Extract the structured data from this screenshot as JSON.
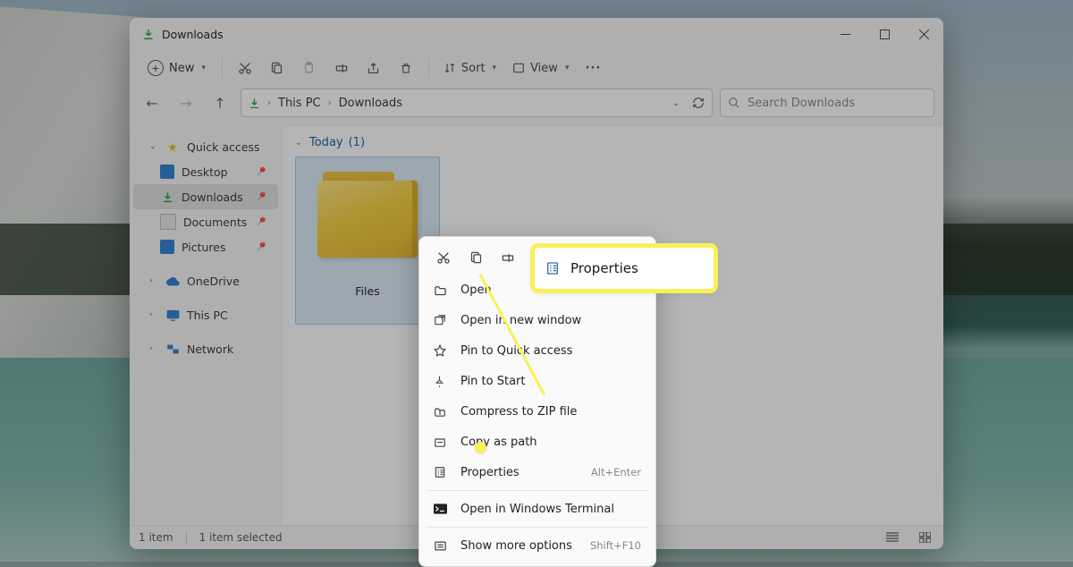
{
  "titlebar": {
    "title": "Downloads"
  },
  "toolbar": {
    "new_label": "New",
    "sort_label": "Sort",
    "view_label": "View"
  },
  "nav": {
    "breadcrumb": [
      "This PC",
      "Downloads"
    ],
    "search_placeholder": "Search Downloads"
  },
  "sidebar": {
    "quick_access": "Quick access",
    "items": [
      {
        "label": "Desktop"
      },
      {
        "label": "Downloads"
      },
      {
        "label": "Documents"
      },
      {
        "label": "Pictures"
      }
    ],
    "onedrive": "OneDrive",
    "this_pc": "This PC",
    "network": "Network"
  },
  "content": {
    "group_label": "Today",
    "group_count": "(1)",
    "folder_name": "Files"
  },
  "status": {
    "count": "1 item",
    "selected": "1 item selected"
  },
  "context_menu": {
    "items": [
      {
        "label": "Open"
      },
      {
        "label": "Open in new window"
      },
      {
        "label": "Pin to Quick access"
      },
      {
        "label": "Pin to Start"
      },
      {
        "label": "Compress to ZIP file"
      },
      {
        "label": "Copy as path"
      },
      {
        "label": "Properties",
        "shortcut": "Alt+Enter"
      },
      {
        "label": "Open in Windows Terminal"
      },
      {
        "label": "Show more options",
        "shortcut": "Shift+F10"
      }
    ]
  },
  "callout": {
    "label": "Properties"
  }
}
